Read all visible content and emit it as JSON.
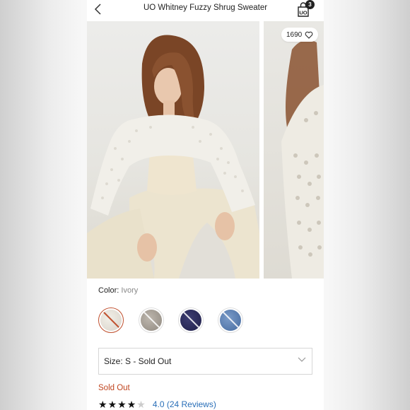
{
  "header": {
    "back_icon": "chevron-left-icon",
    "title": "UO Whitney Fuzzy Shrug Sweater",
    "bag_icon": "shopping-bag-icon",
    "bag_logo": "UO",
    "bag_count": "3"
  },
  "gallery": {
    "likes_count": "1690",
    "likes_icon": "heart-outline-icon"
  },
  "color": {
    "label": "Color:",
    "value": "Ivory",
    "swatches": [
      {
        "name": "Ivory",
        "color": "#e4e0d8",
        "selected": true
      },
      {
        "name": "Grey",
        "color": "#a9a29a",
        "selected": false
      },
      {
        "name": "Navy",
        "color": "#2d2d5e",
        "selected": false
      },
      {
        "name": "Blue",
        "color": "#5b7fb3",
        "selected": false
      }
    ]
  },
  "size": {
    "value": "Size: S - Sold Out",
    "chevron_icon": "chevron-down-icon"
  },
  "status": {
    "text": "Sold Out",
    "color": "#c0451f"
  },
  "rating": {
    "value": 4,
    "max": 5,
    "text": "4.0 (24 Reviews)"
  },
  "accent_color": "#c0502e",
  "link_color": "#2a6fb8"
}
